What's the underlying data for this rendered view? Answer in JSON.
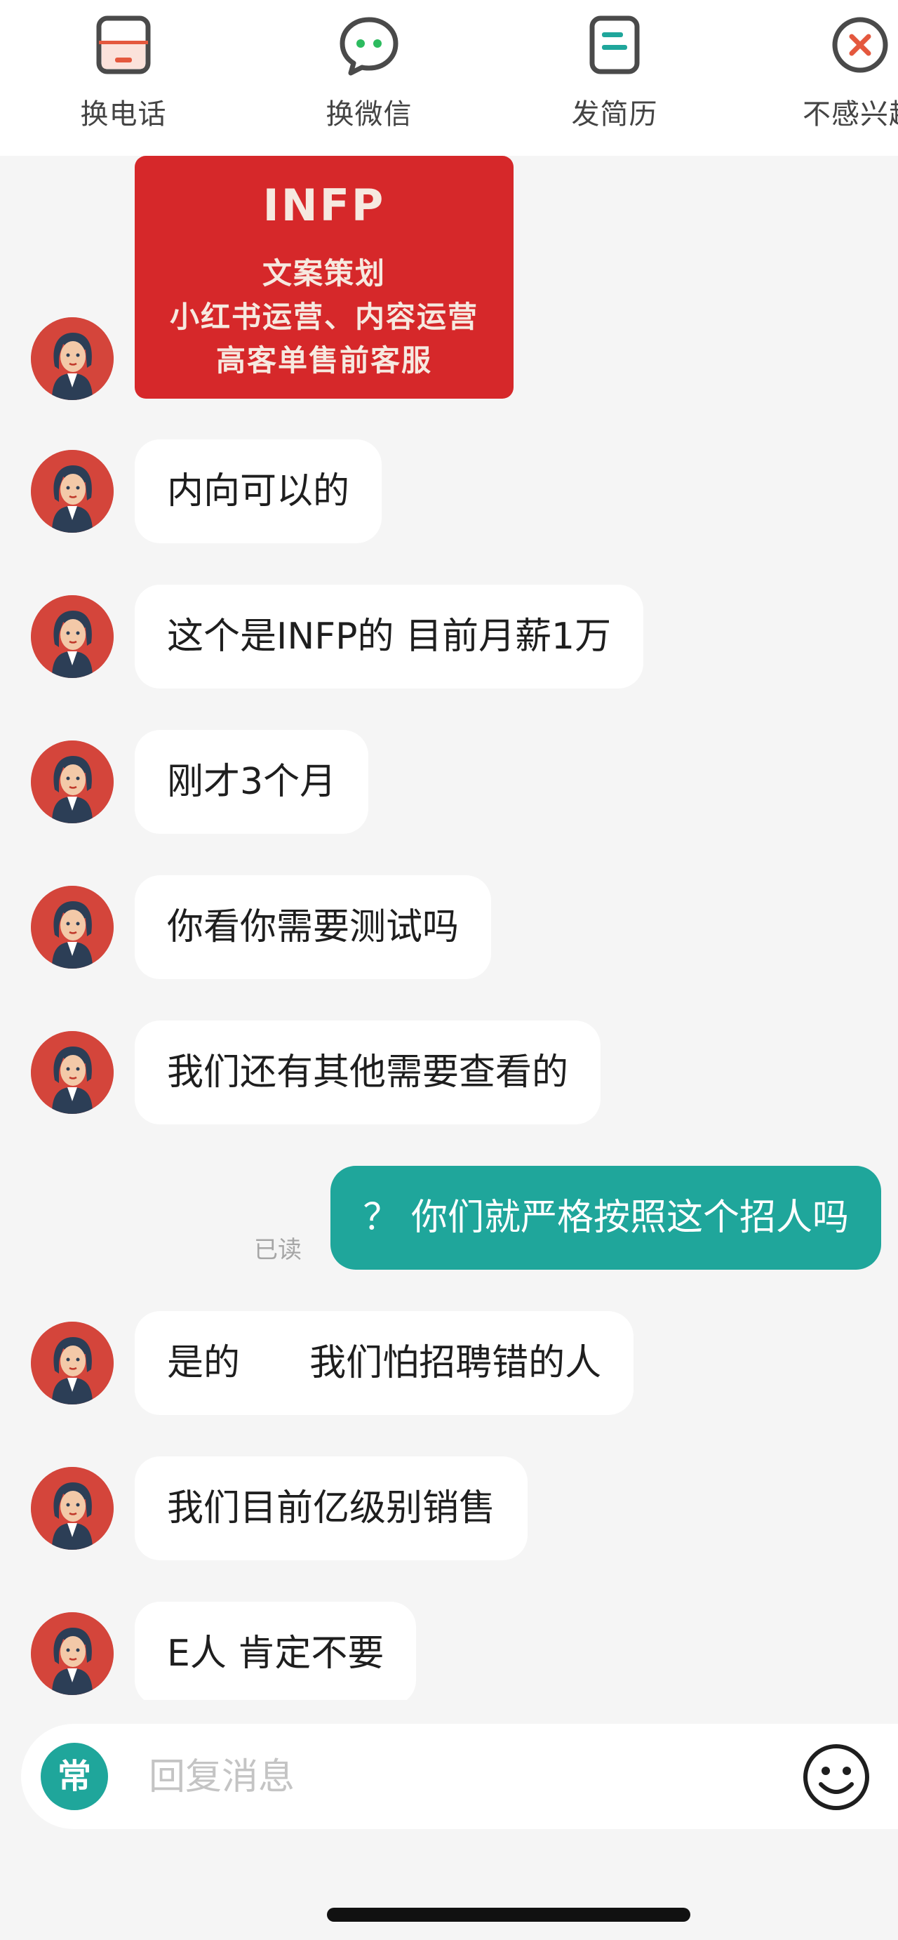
{
  "top_actions": {
    "call": {
      "label": "换电话",
      "icon": "phone-swap-icon",
      "color": "#e4583e"
    },
    "wechat": {
      "label": "换微信",
      "icon": "wechat-icon",
      "color": "#2dbb5f"
    },
    "resume": {
      "label": "发简历",
      "icon": "resume-icon",
      "color": "#1fa69b"
    },
    "not_interested": {
      "label": "不感兴趣",
      "icon": "close-circle-icon",
      "color": "#e4583e"
    }
  },
  "messages": [
    {
      "sender": "recruiter",
      "type": "image",
      "lines": [
        "INFP",
        "文案策划",
        "小红书运营、内容运营",
        "高客单售前客服"
      ]
    },
    {
      "sender": "recruiter",
      "text": "内向可以的"
    },
    {
      "sender": "recruiter",
      "text": "这个是INFP的 目前月薪1万"
    },
    {
      "sender": "recruiter",
      "text": "刚才3个月"
    },
    {
      "sender": "recruiter",
      "text": "你看你需要测试吗"
    },
    {
      "sender": "recruiter",
      "text": "我们还有其他需要查看的"
    },
    {
      "sender": "me",
      "text": "？ 你们就严格按照这个招人吗",
      "status": "已读"
    },
    {
      "sender": "recruiter",
      "text": "是的      我们怕招聘错的人"
    },
    {
      "sender": "recruiter",
      "text": "我们目前亿级别销售"
    },
    {
      "sender": "recruiter",
      "text": "E人 肯定不要"
    }
  ],
  "input_bar": {
    "quick_reply_label": "常",
    "placeholder": "回复消息",
    "emoji_icon": "smiley-icon"
  },
  "colors": {
    "accent": "#1fa69b",
    "card_red": "#d6282a",
    "avatar_bg": "#d4453b"
  }
}
